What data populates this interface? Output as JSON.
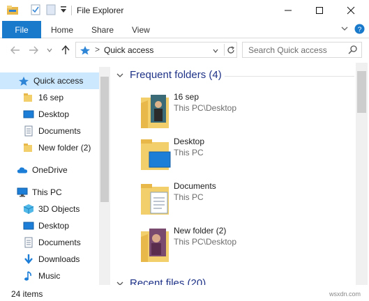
{
  "window": {
    "title": "File Explorer"
  },
  "window_controls": {
    "minimize": "—",
    "maximize": "☐",
    "close": "✕"
  },
  "ribbon": {
    "file_tab": "File",
    "tabs": [
      "Home",
      "Share",
      "View"
    ],
    "expand_glyph": "⌄",
    "help_glyph": "?"
  },
  "address": {
    "crumb": "Quick access",
    "separator": ">",
    "dropdown": "⌄",
    "refresh": "↻"
  },
  "search": {
    "placeholder": "Search Quick access"
  },
  "nav_pane": {
    "items": [
      {
        "label": "Quick access",
        "icon": "star-icon"
      },
      {
        "label": "16 sep",
        "icon": "folder-icon"
      },
      {
        "label": "Desktop",
        "icon": "desktop-icon"
      },
      {
        "label": "Documents",
        "icon": "documents-icon"
      },
      {
        "label": "New folder (2)",
        "icon": "folder-icon"
      },
      {
        "label": "OneDrive",
        "icon": "cloud-icon"
      },
      {
        "label": "This PC",
        "icon": "computer-icon"
      },
      {
        "label": "3D Objects",
        "icon": "cube-icon"
      },
      {
        "label": "Desktop",
        "icon": "desktop-icon"
      },
      {
        "label": "Documents",
        "icon": "documents-icon"
      },
      {
        "label": "Downloads",
        "icon": "download-icon"
      },
      {
        "label": "Music",
        "icon": "music-icon"
      }
    ]
  },
  "content": {
    "frequent_header": "Frequent folders (4)",
    "recent_header": "Recent files (20)",
    "frequent_folders": [
      {
        "name": "16 sep",
        "location": "This PC\\Desktop",
        "icon": "folder-with-photo-icon"
      },
      {
        "name": "Desktop",
        "location": "This PC",
        "icon": "desktop-folder-icon"
      },
      {
        "name": "Documents",
        "location": "This PC",
        "icon": "documents-folder-icon"
      },
      {
        "name": "New folder (2)",
        "location": "This PC\\Desktop",
        "icon": "folder-with-photo-icon"
      }
    ]
  },
  "status": {
    "item_count": "24 items",
    "watermark": "wsxdn.com"
  },
  "colors": {
    "accent": "#1979ca",
    "header_blue": "#1e3287",
    "selection": "#cce8ff"
  }
}
